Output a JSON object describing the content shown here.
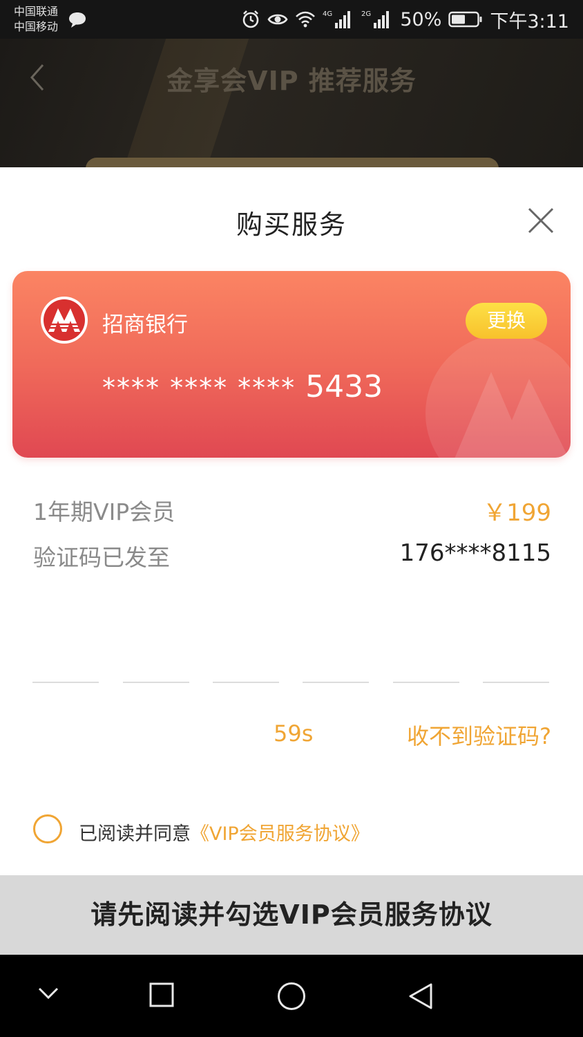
{
  "status_bar": {
    "carrier_1": "中国联通",
    "carrier_2": "中国移动",
    "network_1": "4G",
    "network_2": "2G",
    "battery": "50%",
    "time": "下午3:11",
    "icons": [
      "chat-icon",
      "alarm-icon",
      "eye-icon",
      "wifi-icon",
      "signal-icon",
      "battery-icon"
    ]
  },
  "background_page": {
    "title": "金享会VIP 推荐服务",
    "back_icon": "chevron-left-icon"
  },
  "sheet": {
    "title": "购买服务",
    "close_icon": "close-icon"
  },
  "bank_card": {
    "bank_name": "招商银行",
    "change_label": "更换",
    "number_mask": "**** **** ****",
    "number_last4": "5433",
    "logo_icon": "cmb-logo-icon",
    "colors": {
      "top": "#fb8463",
      "bottom": "#e04852",
      "button": "#f8c12c"
    }
  },
  "order": {
    "product_label": "1年期VIP会员",
    "price": "￥199",
    "sms_label": "验证码已发至",
    "phone": "176****8115"
  },
  "verification": {
    "digit_count": 6,
    "countdown": "59s",
    "resend_label": "收不到验证码?"
  },
  "agreement": {
    "prefix": "已阅读并同意",
    "link": "《VIP会员服务协议》",
    "checked": false
  },
  "submit": {
    "label": "请先阅读并勾选VIP会员服务协议",
    "enabled": false
  },
  "nav_bar": {
    "icons": [
      "chevron-down-icon",
      "recents-square-icon",
      "home-circle-icon",
      "back-triangle-icon"
    ]
  },
  "theme": {
    "accent": "#f0a534",
    "disabled_button": "#d8d8d8"
  }
}
